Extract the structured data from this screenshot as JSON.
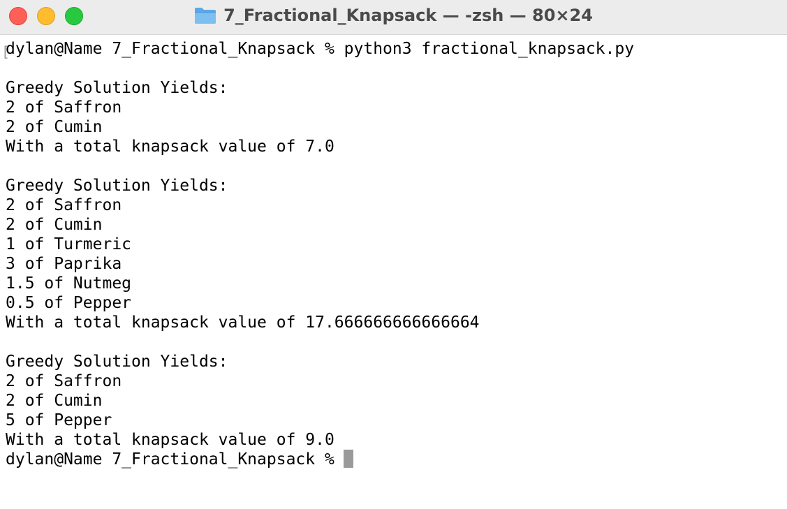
{
  "window": {
    "title": "7_Fractional_Knapsack — -zsh — 80×24",
    "folder_icon": "folder-icon",
    "colors": {
      "close": "#fe5f57",
      "minimize": "#febc2e",
      "zoom": "#28c840",
      "titlebar": "#ececec",
      "cursor": "#9a9a9a"
    }
  },
  "terminal": {
    "command_line": "dylan@Name 7_Fractional_Knapsack % python3 fractional_knapsack.py",
    "output_lines": [
      "",
      "Greedy Solution Yields:",
      "2 of Saffron",
      "2 of Cumin",
      "With a total knapsack value of 7.0",
      "",
      "Greedy Solution Yields:",
      "2 of Saffron",
      "2 of Cumin",
      "1 of Turmeric",
      "3 of Paprika",
      "1.5 of Nutmeg",
      "0.5 of Pepper",
      "With a total knapsack value of 17.666666666666664",
      "",
      "Greedy Solution Yields:",
      "2 of Saffron",
      "2 of Cumin",
      "5 of Pepper",
      "With a total knapsack value of 9.0"
    ],
    "prompt": "dylan@Name 7_Fractional_Knapsack %"
  }
}
